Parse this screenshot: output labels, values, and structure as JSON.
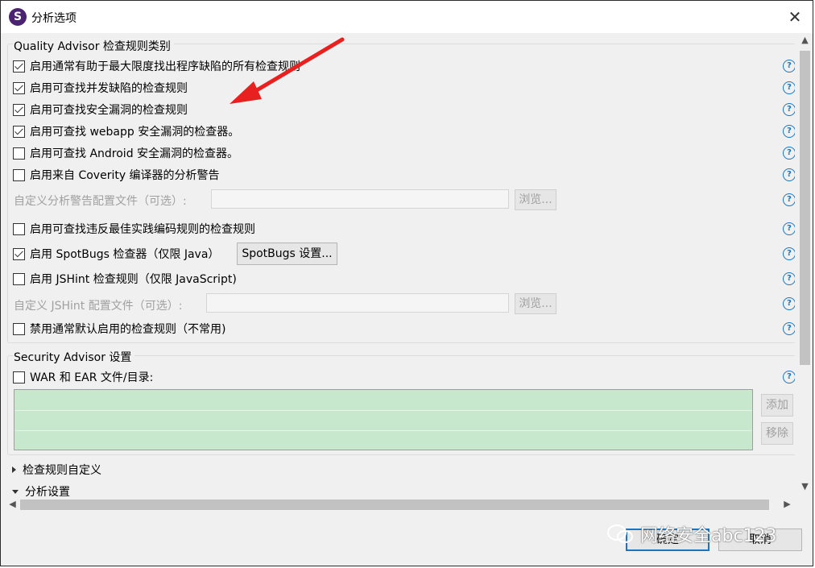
{
  "window": {
    "icon_letter": "S",
    "title": "分析选项",
    "close_glyph": "✕"
  },
  "quality_group": {
    "title": "Quality Advisor 检查规则类别",
    "rules": [
      {
        "label": "启用通常有助于最大限度找出程序缺陷的所有检查规则",
        "checked": true
      },
      {
        "label": "启用可查找并发缺陷的检查规则",
        "checked": true
      },
      {
        "label": "启用可查找安全漏洞的检查规则",
        "checked": true
      },
      {
        "label": "启用可查找 webapp 安全漏洞的检查器。",
        "checked": true
      },
      {
        "label": "启用可查找 Android 安全漏洞的检查器。",
        "checked": false
      },
      {
        "label": "启用来自 Coverity 编译器的分析警告",
        "checked": false
      }
    ],
    "custom_warning_label": "自定义分析警告配置文件（可选）:",
    "browse_label_1": "浏览...",
    "best_practice_rule": {
      "label": "启用可查找违反最佳实践编码规则的检查规则",
      "checked": false
    },
    "spotbugs_rule": {
      "label": "启用 SpotBugs 检查器（仅限 Java）",
      "checked": true
    },
    "spotbugs_settings_button": "SpotBugs 设置...",
    "jshint_rule": {
      "label": "启用 JSHint 检查规则（仅限 JavaScript)",
      "checked": false
    },
    "jshint_config_label": "自定义 JSHint 配置文件（可选）:",
    "browse_label_2": "浏览...",
    "disable_default_rule": {
      "label": "禁用通常默认启用的检查规则（不常用)",
      "checked": false
    }
  },
  "security_group": {
    "title": "Security Advisor 设置",
    "war_ear_label": "WAR 和 EAR 文件/目录:",
    "war_ear_checked": false,
    "add_button": "添加",
    "remove_button": "移除"
  },
  "sections": {
    "rule_customization": "检查规则自定义",
    "analysis_settings": "分析设置"
  },
  "help_glyph": "?",
  "footer": {
    "ok_label": "确定",
    "cancel_label": "取消"
  },
  "watermark": {
    "text": "网络安全abc123"
  },
  "colors": {
    "annotation_arrow": "#e8201f",
    "list_background": "#c8e8cd",
    "help_icon": "#1c75bc",
    "app_icon": "#4a2371"
  }
}
